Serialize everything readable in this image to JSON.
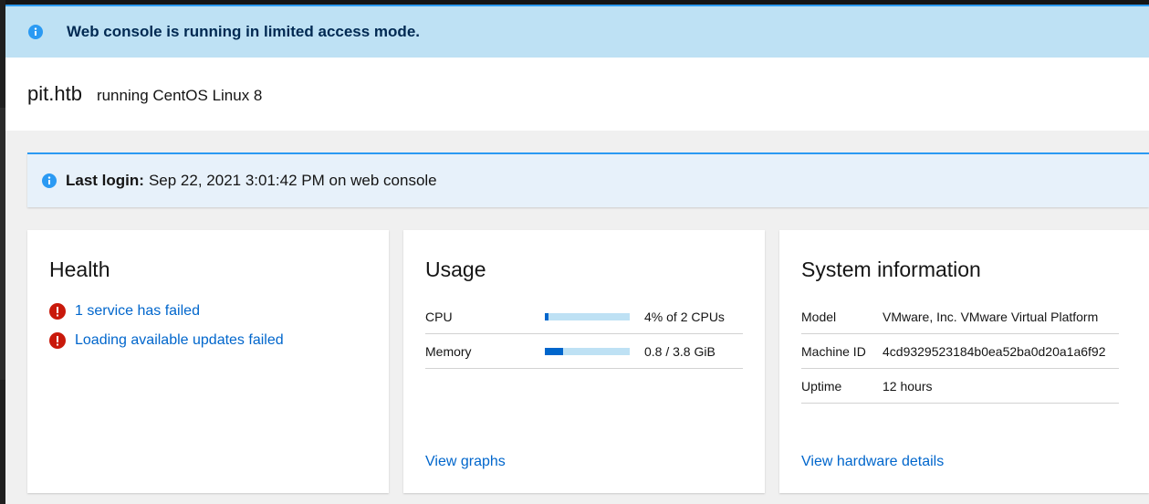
{
  "banner": {
    "text": "Web console is running in limited access mode.",
    "icon": "info-icon"
  },
  "header": {
    "hostname": "pit.htb",
    "os": "running CentOS Linux 8"
  },
  "last_login": {
    "label": "Last login:",
    "value": "Sep 22, 2021 3:01:42 PM on web console"
  },
  "health": {
    "title": "Health",
    "items": [
      {
        "text": "1 service has failed",
        "icon": "error-icon"
      },
      {
        "text": "Loading available updates failed",
        "icon": "error-icon"
      }
    ]
  },
  "usage": {
    "title": "Usage",
    "rows": [
      {
        "label": "CPU",
        "value": "4% of 2 CPUs",
        "fraction": 0.04
      },
      {
        "label": "Memory",
        "value": "0.8 / 3.8 GiB",
        "fraction": 0.21
      }
    ],
    "link": "View graphs"
  },
  "system_info": {
    "title": "System information",
    "rows": [
      {
        "label": "Model",
        "value": "VMware, Inc. VMware Virtual Platform"
      },
      {
        "label": "Machine ID",
        "value": "4cd9329523184b0ea52ba0d20a1a6f92"
      },
      {
        "label": "Uptime",
        "value": "12 hours"
      }
    ],
    "link": "View hardware details"
  },
  "colors": {
    "info_bg": "#bee1f4",
    "link": "#0066cc",
    "error": "#c9190b",
    "accent": "#2b9af3"
  }
}
